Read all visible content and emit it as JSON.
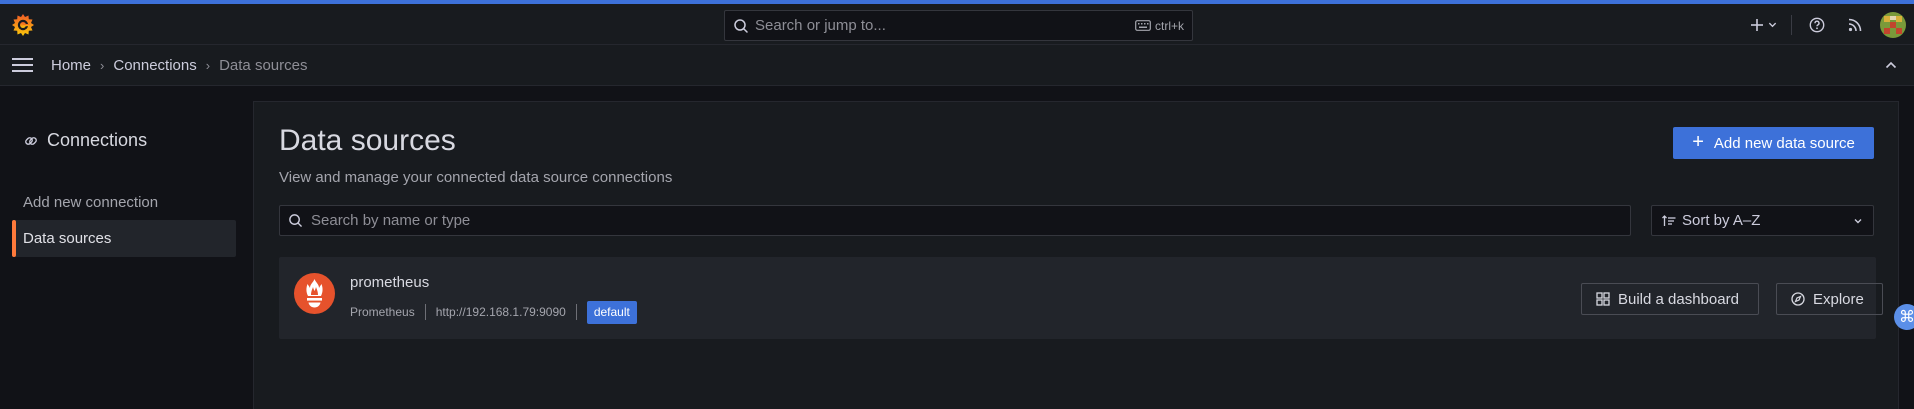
{
  "colors": {
    "accent_line": "#3d71d9",
    "primary_button": "#3d71d9",
    "active_indicator": "#ff7a3b",
    "prometheus_logo": "#e6522c"
  },
  "topbar": {
    "search_placeholder": "Search or jump to...",
    "search_shortcut": "ctrl+k",
    "icons": [
      "grafana-logo-icon",
      "search-icon",
      "keyboard-icon",
      "plus-icon",
      "chevron-down-icon",
      "help-icon",
      "news-rss-icon",
      "user-avatar"
    ]
  },
  "breadcrumb": {
    "items": [
      "Home",
      "Connections",
      "Data sources"
    ],
    "separator": "›"
  },
  "sidebar": {
    "title": "Connections",
    "items": [
      {
        "label": "Add new connection",
        "active": false
      },
      {
        "label": "Data sources",
        "active": true
      }
    ]
  },
  "main": {
    "title": "Data sources",
    "subtitle": "View and manage your connected data source connections",
    "add_button": "Add new data source",
    "filter_placeholder": "Search by name or type",
    "sort_value": "Sort by A–Z",
    "datasources": [
      {
        "name": "prometheus",
        "type": "Prometheus",
        "url": "http://192.168.1.79:9090",
        "badge": "default",
        "build_button": "Build a dashboard",
        "explore_button": "Explore"
      }
    ]
  }
}
